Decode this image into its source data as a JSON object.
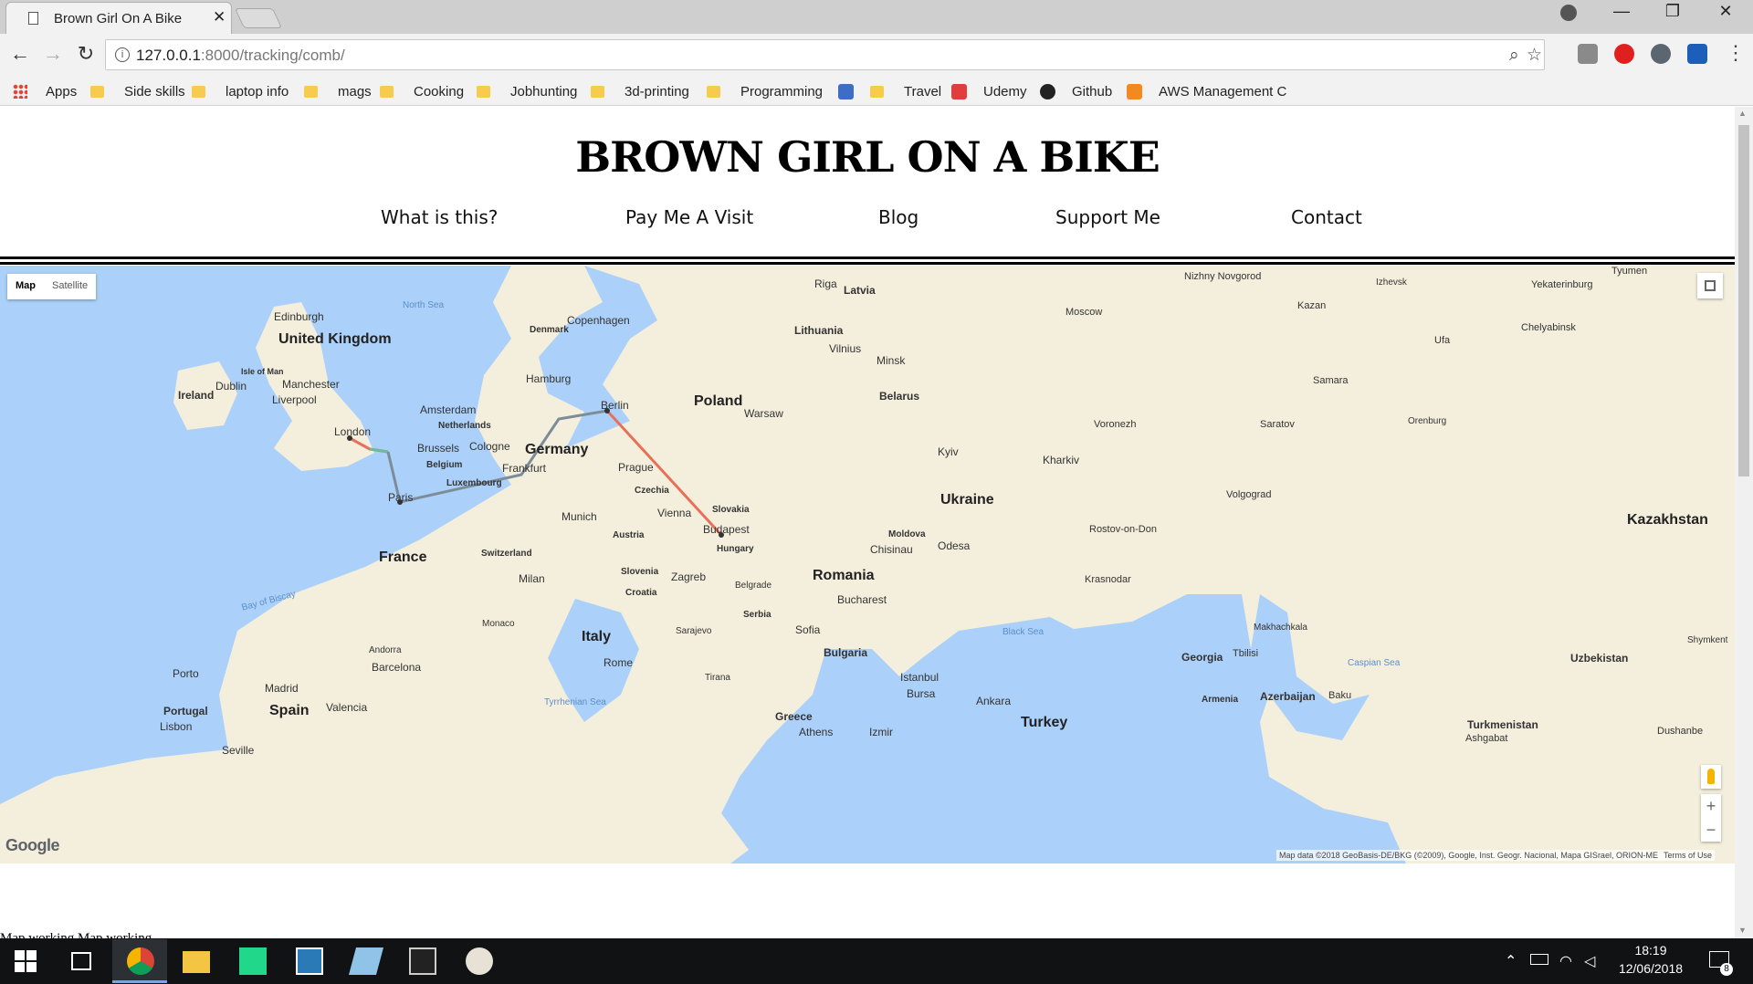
{
  "browser": {
    "tab_title": "Brown Girl On A Bike",
    "tab_close": "✕",
    "url_host": "127.0.0.1",
    "url_path": ":8000/tracking/comb/",
    "window_controls": [
      "—",
      "❐",
      "✕"
    ],
    "bookmarks": [
      {
        "label": "Apps",
        "icon": "apps-icon"
      },
      {
        "label": "Side skills",
        "icon": "folder-icon"
      },
      {
        "label": "laptop info",
        "icon": "folder-icon"
      },
      {
        "label": "mags",
        "icon": "folder-icon"
      },
      {
        "label": "Cooking",
        "icon": "folder-icon"
      },
      {
        "label": "Jobhunting",
        "icon": "folder-icon"
      },
      {
        "label": "3d-printing",
        "icon": "folder-icon"
      },
      {
        "label": "Programming",
        "icon": "folder-icon"
      },
      {
        "label": "Travel",
        "icon": "folder-icon"
      },
      {
        "label": "Udemy",
        "icon": "udemy-icon"
      },
      {
        "label": "Github",
        "icon": "github-icon"
      },
      {
        "label": "AWS Management C",
        "icon": "aws-icon"
      }
    ]
  },
  "site": {
    "title": "BROWN GIRL ON A BIKE",
    "nav": [
      "What is this?",
      "Pay Me A Visit",
      "Blog",
      "Support Me",
      "Contact"
    ]
  },
  "map": {
    "type_control": {
      "map": "Map",
      "satellite": "Satellite"
    },
    "zoom_in": "+",
    "zoom_out": "−",
    "google_logo": "Google",
    "attribution": "Map data ©2018 GeoBasis-DE/BKG (©2009), Google, Inst. Geogr. Nacional, Mapa GISrael, ORION-ME",
    "terms": "Terms of Use",
    "route_colors": {
      "uk_segment": "#e8705a",
      "channel_segment": "#6dbb9c",
      "france_germany": "#7c8c99",
      "berlin_budapest": "#e8705a"
    },
    "labels": [
      {
        "text": "United Kingdom",
        "kind": "country"
      },
      {
        "text": "Ireland",
        "kind": "country"
      },
      {
        "text": "Poland",
        "kind": "country"
      },
      {
        "text": "Germany",
        "kind": "country"
      },
      {
        "text": "France",
        "kind": "country"
      },
      {
        "text": "Ukraine",
        "kind": "country"
      },
      {
        "text": "Romania",
        "kind": "country"
      },
      {
        "text": "Italy",
        "kind": "country"
      },
      {
        "text": "Spain",
        "kind": "country"
      },
      {
        "text": "Turkey",
        "kind": "country"
      },
      {
        "text": "Kazakhstan",
        "kind": "country"
      },
      {
        "text": "Uzbekistan",
        "kind": "country"
      },
      {
        "text": "Latvia",
        "kind": "city"
      },
      {
        "text": "Lithuania",
        "kind": "city"
      },
      {
        "text": "Belarus",
        "kind": "city"
      },
      {
        "text": "Moldova",
        "kind": "city"
      },
      {
        "text": "Czechia",
        "kind": "city"
      },
      {
        "text": "Slovakia",
        "kind": "city"
      },
      {
        "text": "Austria",
        "kind": "city"
      },
      {
        "text": "Hungary",
        "kind": "city"
      },
      {
        "text": "Switzerland",
        "kind": "city"
      },
      {
        "text": "Belgium",
        "kind": "city"
      },
      {
        "text": "Netherlands",
        "kind": "city"
      },
      {
        "text": "Luxembourg",
        "kind": "city"
      },
      {
        "text": "Denmark",
        "kind": "city"
      },
      {
        "text": "Slovenia",
        "kind": "city"
      },
      {
        "text": "Croatia",
        "kind": "city"
      },
      {
        "text": "Serbia",
        "kind": "city"
      },
      {
        "text": "Bulgaria",
        "kind": "city"
      },
      {
        "text": "Greece",
        "kind": "city"
      },
      {
        "text": "Portugal",
        "kind": "city"
      },
      {
        "text": "Georgia",
        "kind": "city"
      },
      {
        "text": "Armenia",
        "kind": "city"
      },
      {
        "text": "Azerbaijan",
        "kind": "city"
      },
      {
        "text": "Turkmenistan",
        "kind": "city"
      },
      {
        "text": "London",
        "kind": "city"
      },
      {
        "text": "Paris",
        "kind": "city"
      },
      {
        "text": "Berlin",
        "kind": "city"
      },
      {
        "text": "Budapest",
        "kind": "city"
      },
      {
        "text": "Vienna",
        "kind": "city"
      },
      {
        "text": "Prague",
        "kind": "city"
      },
      {
        "text": "Munich",
        "kind": "city"
      },
      {
        "text": "Frankfurt",
        "kind": "city"
      },
      {
        "text": "Cologne",
        "kind": "city"
      },
      {
        "text": "Brussels",
        "kind": "city"
      },
      {
        "text": "Amsterdam",
        "kind": "city"
      },
      {
        "text": "Hamburg",
        "kind": "city"
      },
      {
        "text": "Copenhagen",
        "kind": "city"
      },
      {
        "text": "Warsaw",
        "kind": "city"
      },
      {
        "text": "Vilnius",
        "kind": "city"
      },
      {
        "text": "Minsk",
        "kind": "city"
      },
      {
        "text": "Riga",
        "kind": "city"
      },
      {
        "text": "Kyiv",
        "kind": "city"
      },
      {
        "text": "Kharkiv",
        "kind": "city"
      },
      {
        "text": "Odesa",
        "kind": "city"
      },
      {
        "text": "Chisinau",
        "kind": "city"
      },
      {
        "text": "Bucharest",
        "kind": "city"
      },
      {
        "text": "Sofia",
        "kind": "city"
      },
      {
        "text": "Belgrade",
        "kind": "city"
      },
      {
        "text": "Zagreb",
        "kind": "city"
      },
      {
        "text": "Sarajevo",
        "kind": "city"
      },
      {
        "text": "Milan",
        "kind": "city"
      },
      {
        "text": "Rome",
        "kind": "city"
      },
      {
        "text": "Monaco",
        "kind": "city"
      },
      {
        "text": "Andorra",
        "kind": "city"
      },
      {
        "text": "Barcelona",
        "kind": "city"
      },
      {
        "text": "Madrid",
        "kind": "city"
      },
      {
        "text": "Valencia",
        "kind": "city"
      },
      {
        "text": "Porto",
        "kind": "city"
      },
      {
        "text": "Lisbon",
        "kind": "city"
      },
      {
        "text": "Seville",
        "kind": "city"
      },
      {
        "text": "Istanbul",
        "kind": "city"
      },
      {
        "text": "Bursa",
        "kind": "city"
      },
      {
        "text": "Ankara",
        "kind": "city"
      },
      {
        "text": "Izmir",
        "kind": "city"
      },
      {
        "text": "Athens",
        "kind": "city"
      },
      {
        "text": "Tirana",
        "kind": "city"
      },
      {
        "text": "Edinburgh",
        "kind": "city"
      },
      {
        "text": "Isle of Man",
        "kind": "city"
      },
      {
        "text": "Dublin",
        "kind": "city"
      },
      {
        "text": "Manchester",
        "kind": "city"
      },
      {
        "text": "Liverpool",
        "kind": "city"
      },
      {
        "text": "Moscow",
        "kind": "city"
      },
      {
        "text": "Voronezh",
        "kind": "city"
      },
      {
        "text": "Saratov",
        "kind": "city"
      },
      {
        "text": "Volgograd",
        "kind": "city"
      },
      {
        "text": "Rostov-on-Don",
        "kind": "city"
      },
      {
        "text": "Krasnodar",
        "kind": "city"
      },
      {
        "text": "Samara",
        "kind": "city"
      },
      {
        "text": "Kazan",
        "kind": "city"
      },
      {
        "text": "Ufa",
        "kind": "city"
      },
      {
        "text": "Orenburg",
        "kind": "city"
      },
      {
        "text": "Chelyabinsk",
        "kind": "city"
      },
      {
        "text": "Yekaterinburg",
        "kind": "city"
      },
      {
        "text": "Tyumen",
        "kind": "city"
      },
      {
        "text": "Izhevsk",
        "kind": "city"
      },
      {
        "text": "Nizhny Novgorod",
        "kind": "city"
      },
      {
        "text": "Makhachkala",
        "kind": "city"
      },
      {
        "text": "Tbilisi",
        "kind": "city"
      },
      {
        "text": "Baku",
        "kind": "city"
      },
      {
        "text": "Ashgabat",
        "kind": "city"
      },
      {
        "text": "Dushanbe",
        "kind": "city"
      },
      {
        "text": "Shymkent",
        "kind": "city"
      },
      {
        "text": "North Sea",
        "kind": "sea"
      },
      {
        "text": "Bay of Biscay",
        "kind": "sea"
      },
      {
        "text": "Tyrrhenian Sea",
        "kind": "sea"
      },
      {
        "text": "Black Sea",
        "kind": "sea"
      },
      {
        "text": "Caspian Sea",
        "kind": "sea"
      }
    ]
  },
  "page_footer_text": "Map working Map working",
  "taskbar": {
    "time": "18:19",
    "date": "12/06/2018",
    "notification_count": "8"
  }
}
